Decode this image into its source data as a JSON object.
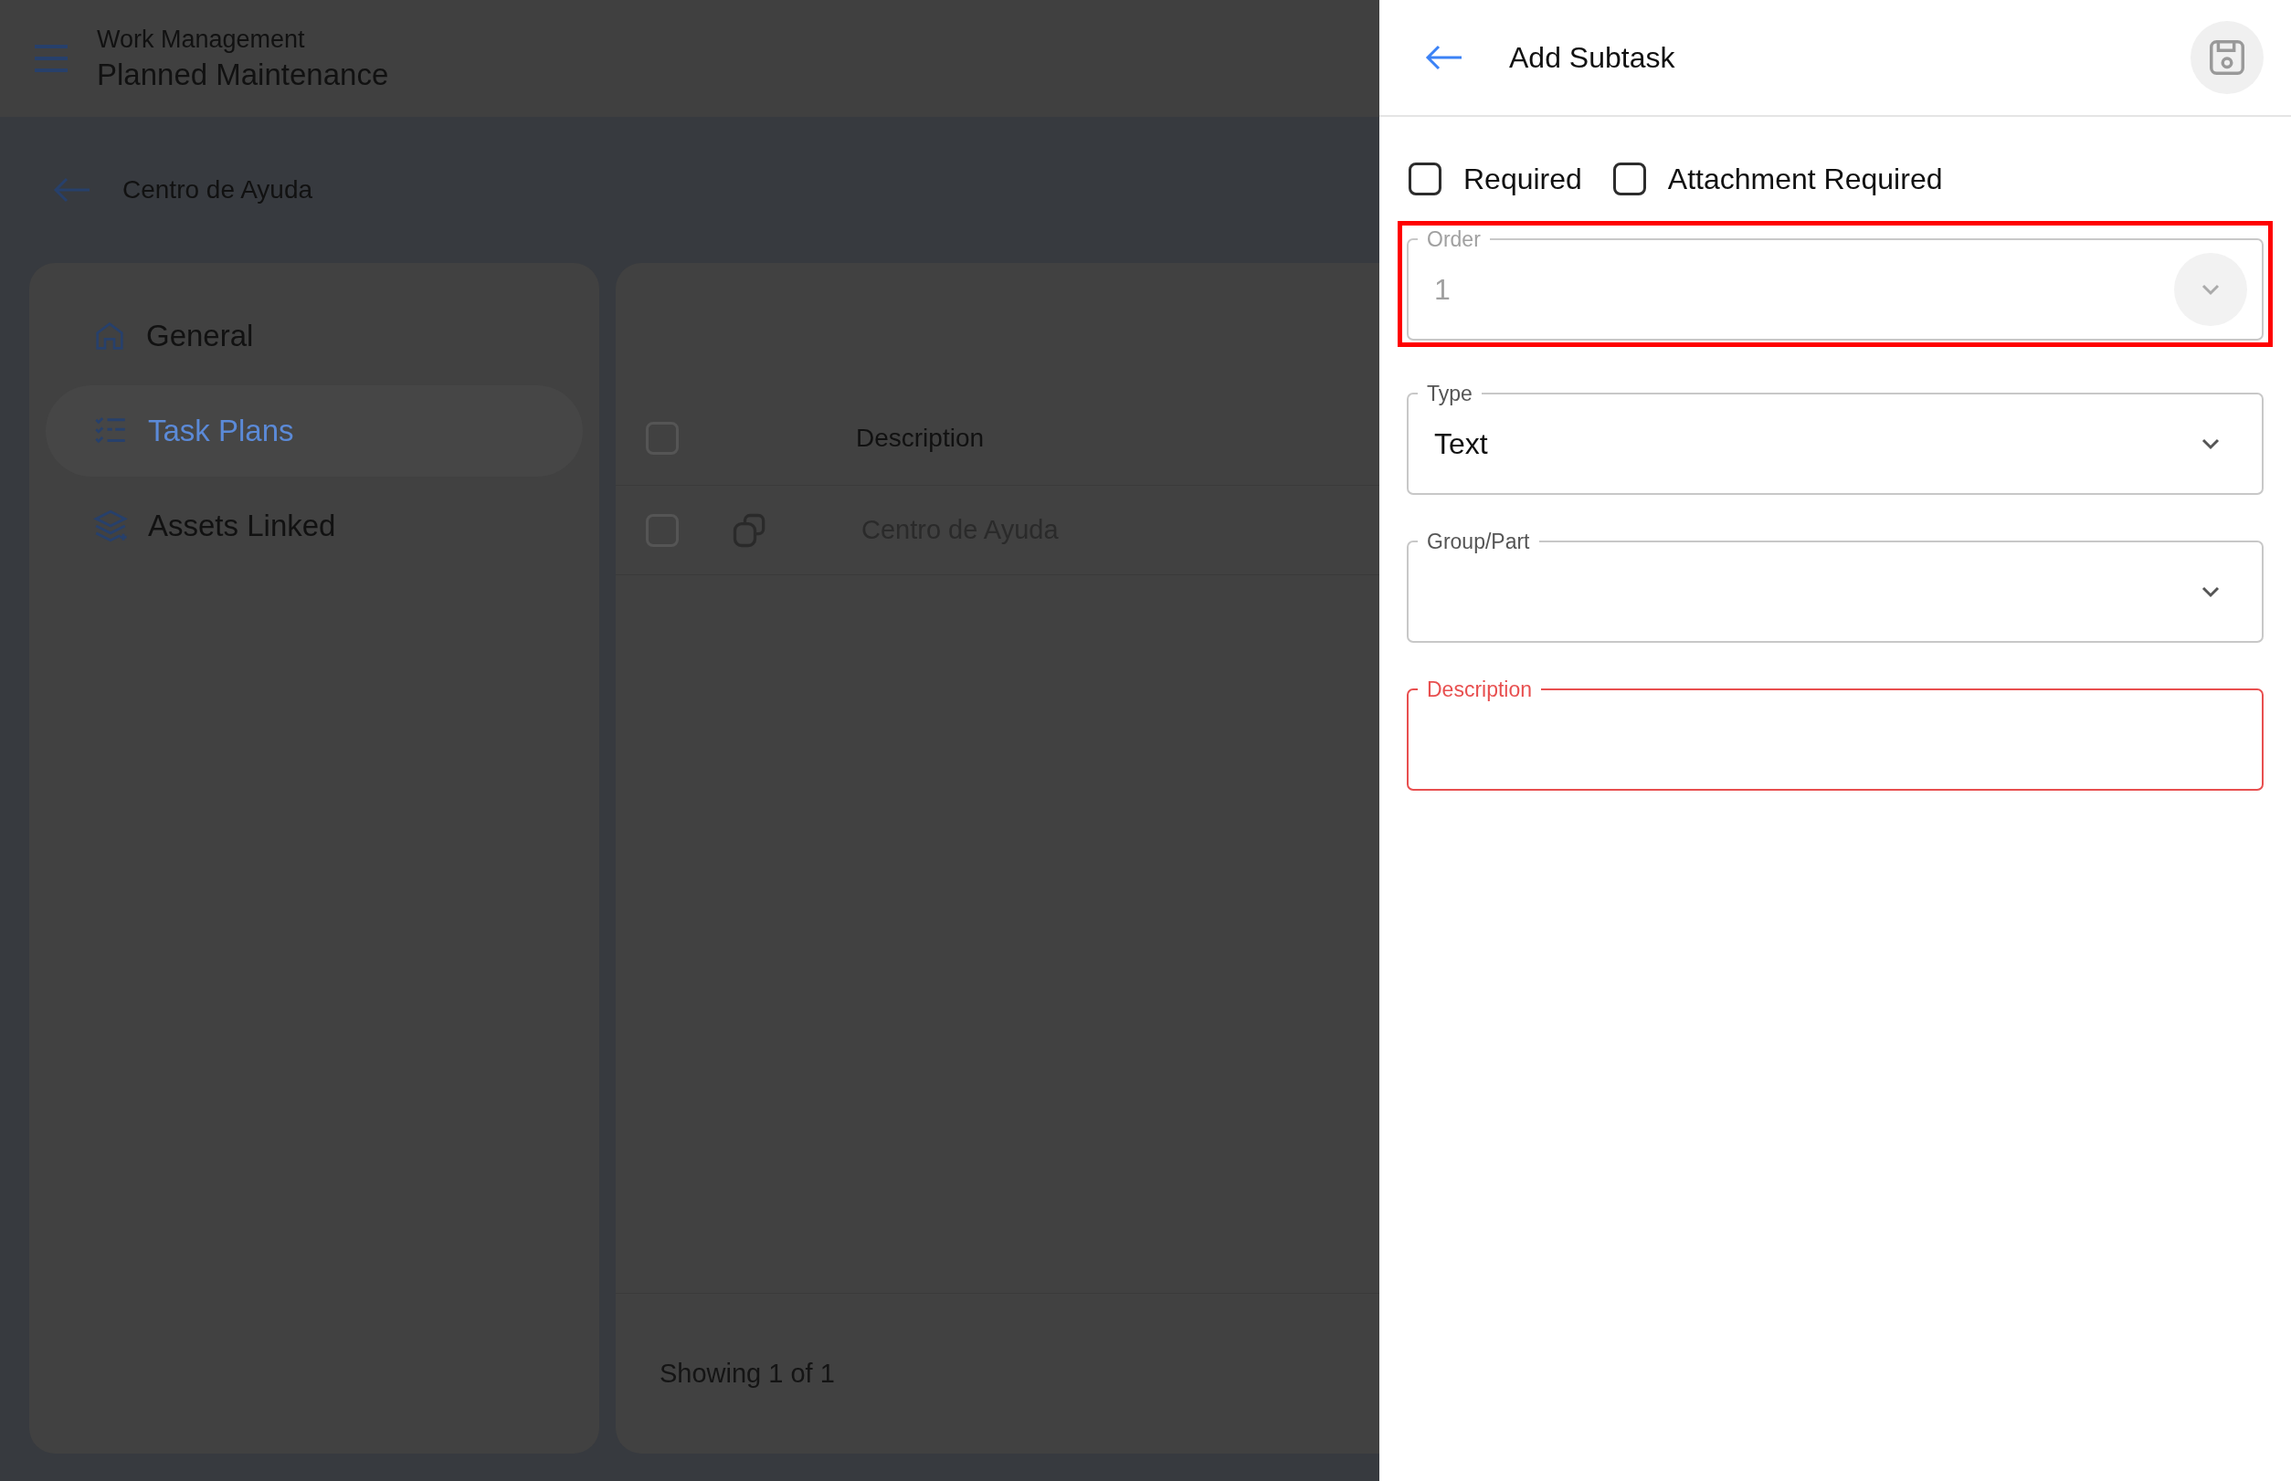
{
  "app_bar": {
    "section": "Work Management",
    "title": "Planned Maintenance"
  },
  "back_link": {
    "label": "Centro de Ayuda"
  },
  "sidebar": {
    "items": [
      {
        "label": "General",
        "selected": false
      },
      {
        "label": "Task Plans",
        "selected": true
      },
      {
        "label": "Assets Linked",
        "selected": false
      }
    ]
  },
  "table": {
    "select_all_checked": false,
    "columns": [
      "Description"
    ],
    "rows": [
      {
        "checked": false,
        "description": "Centro de Ayuda"
      }
    ],
    "footer": "Showing 1 of 1"
  },
  "panel": {
    "title": "Add Subtask",
    "checkboxes": [
      {
        "label": "Required",
        "checked": false
      },
      {
        "label": "Attachment Required",
        "checked": false
      }
    ],
    "fields": [
      {
        "label": "Order",
        "value": "1",
        "disabled": true,
        "error": false,
        "highlighted": true,
        "kind": "select"
      },
      {
        "label": "Type",
        "value": "Text",
        "disabled": false,
        "error": false,
        "highlighted": false,
        "kind": "select"
      },
      {
        "label": "Group/Part",
        "disabled": false,
        "error": false,
        "highlighted": false,
        "kind": "select"
      },
      {
        "label": "Description",
        "disabled": false,
        "error": true,
        "highlighted": false,
        "kind": "text"
      }
    ]
  }
}
